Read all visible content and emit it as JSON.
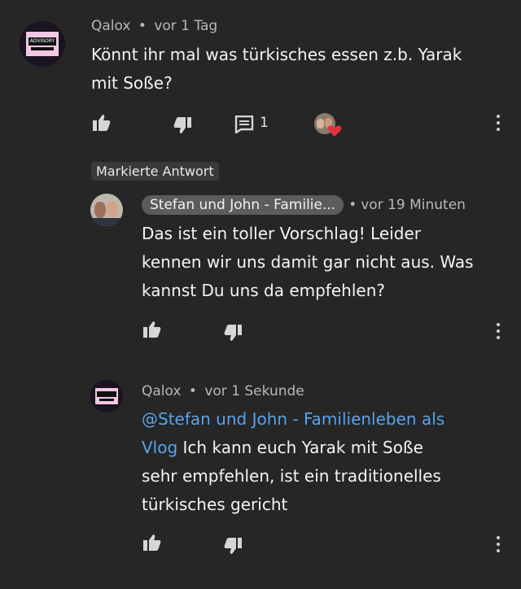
{
  "comment1": {
    "author": "Qalox",
    "separator": "•",
    "time": "vor 1 Tag",
    "text_line1": "Könnt ihr mal was türkisches essen z.b. Yarak",
    "text_line2": "mit Soße?",
    "reply_count": "1",
    "avatar_logo_text": "ADVISORY"
  },
  "highlighted_label": "Markierte Antwort",
  "reply1": {
    "author": "Stefan und John - Familie...",
    "separator": "•",
    "time": "vor 19 Minuten",
    "text_line1": "Das ist ein toller Vorschlag! Leider",
    "text_line2": "kennen wir uns damit gar nicht aus. Was",
    "text_line3": "kannst Du uns da empfehlen?"
  },
  "reply2": {
    "author": "Qalox",
    "separator": "•",
    "time": "vor 1 Sekunde",
    "mention_line1": "@Stefan und John - Familienleben als",
    "mention_line2": "Vlog",
    "text_line2_rest": " Ich kann euch Yarak mit Soße",
    "text_line3": "sehr empfehlen, ist ein traditionelles",
    "text_line4": "türkisches gericht"
  },
  "colors": {
    "background": "#262626",
    "mention": "#5aa3ea",
    "heart": "#e0313e"
  },
  "icons": [
    "like-icon",
    "dislike-icon",
    "reply-icon",
    "heart-icon",
    "more-vert-icon"
  ]
}
